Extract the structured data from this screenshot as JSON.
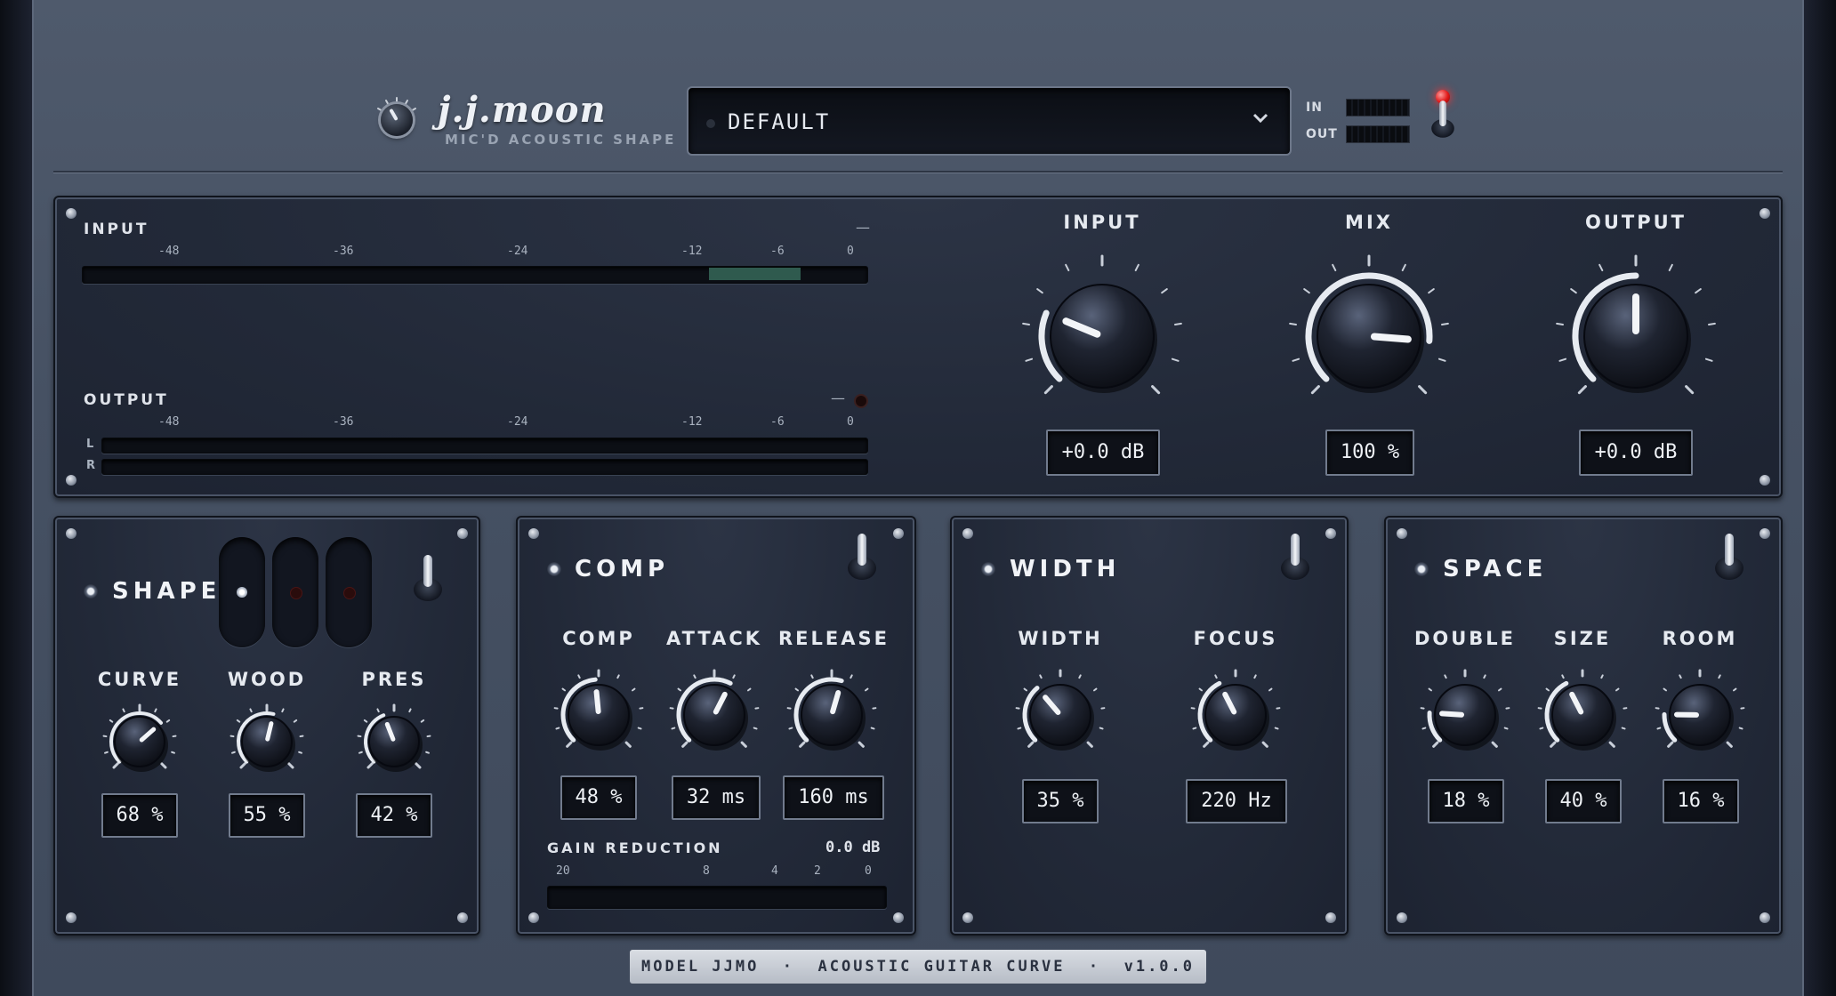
{
  "header": {
    "brand": "j.j.moon",
    "tagline": "MIC'D ACOUSTIC SHAPE",
    "preset": "DEFAULT",
    "in_label": "IN",
    "out_label": "OUT"
  },
  "meters": {
    "input": {
      "label": "INPUT",
      "ticks": [
        "-48",
        "-36",
        "-24",
        "-12",
        "-6",
        "0"
      ],
      "peak_readout": "—",
      "level_range_db": [
        -12,
        -5
      ]
    },
    "output": {
      "label": "OUTPUT",
      "ticks": [
        "-48",
        "-36",
        "-24",
        "-12",
        "-6",
        "0"
      ],
      "peak_readout": "—",
      "channel_l": "L",
      "channel_r": "R"
    }
  },
  "master": {
    "input": {
      "label": "INPUT",
      "value": "+0.0 dB",
      "position": 0.25
    },
    "mix": {
      "label": "MIX",
      "value": "100 %",
      "position": 0.85
    },
    "output": {
      "label": "OUTPUT",
      "value": "+0.0 dB",
      "position": 0.5
    }
  },
  "shape": {
    "title": "SHAPE",
    "curve": {
      "label": "CURVE",
      "value": "68 %",
      "position": 0.68
    },
    "wood": {
      "label": "WOOD",
      "value": "55 %",
      "position": 0.55
    },
    "pres": {
      "label": "PRES",
      "value": "42 %",
      "position": 0.42
    }
  },
  "comp": {
    "title": "COMP",
    "comp": {
      "label": "COMP",
      "value": "48 %",
      "position": 0.48
    },
    "attack": {
      "label": "ATTACK",
      "value": "32 ms",
      "position": 0.6
    },
    "release": {
      "label": "RELEASE",
      "value": "160 ms",
      "position": 0.56
    },
    "gr_label": "GAIN REDUCTION",
    "gr_value": "0.0 dB",
    "gr_ticks": [
      "20",
      "8",
      "4",
      "2",
      "0"
    ]
  },
  "width": {
    "title": "WIDTH",
    "width": {
      "label": "WIDTH",
      "value": "35 %",
      "position": 0.35
    },
    "focus": {
      "label": "FOCUS",
      "value": "220 Hz",
      "position": 0.4
    }
  },
  "space": {
    "title": "SPACE",
    "double": {
      "label": "DOUBLE",
      "value": "18 %",
      "position": 0.18
    },
    "size": {
      "label": "SIZE",
      "value": "40 %",
      "position": 0.4
    },
    "room": {
      "label": "ROOM",
      "value": "16 %",
      "position": 0.17
    }
  },
  "footer": "MODEL JJMO  ·  ACOUSTIC GUITAR CURVE  ·  v1.0.0",
  "colors": {
    "meter_fill": "#2f5a4e",
    "power_led": "#e01818",
    "accent": "#eef1f5"
  }
}
